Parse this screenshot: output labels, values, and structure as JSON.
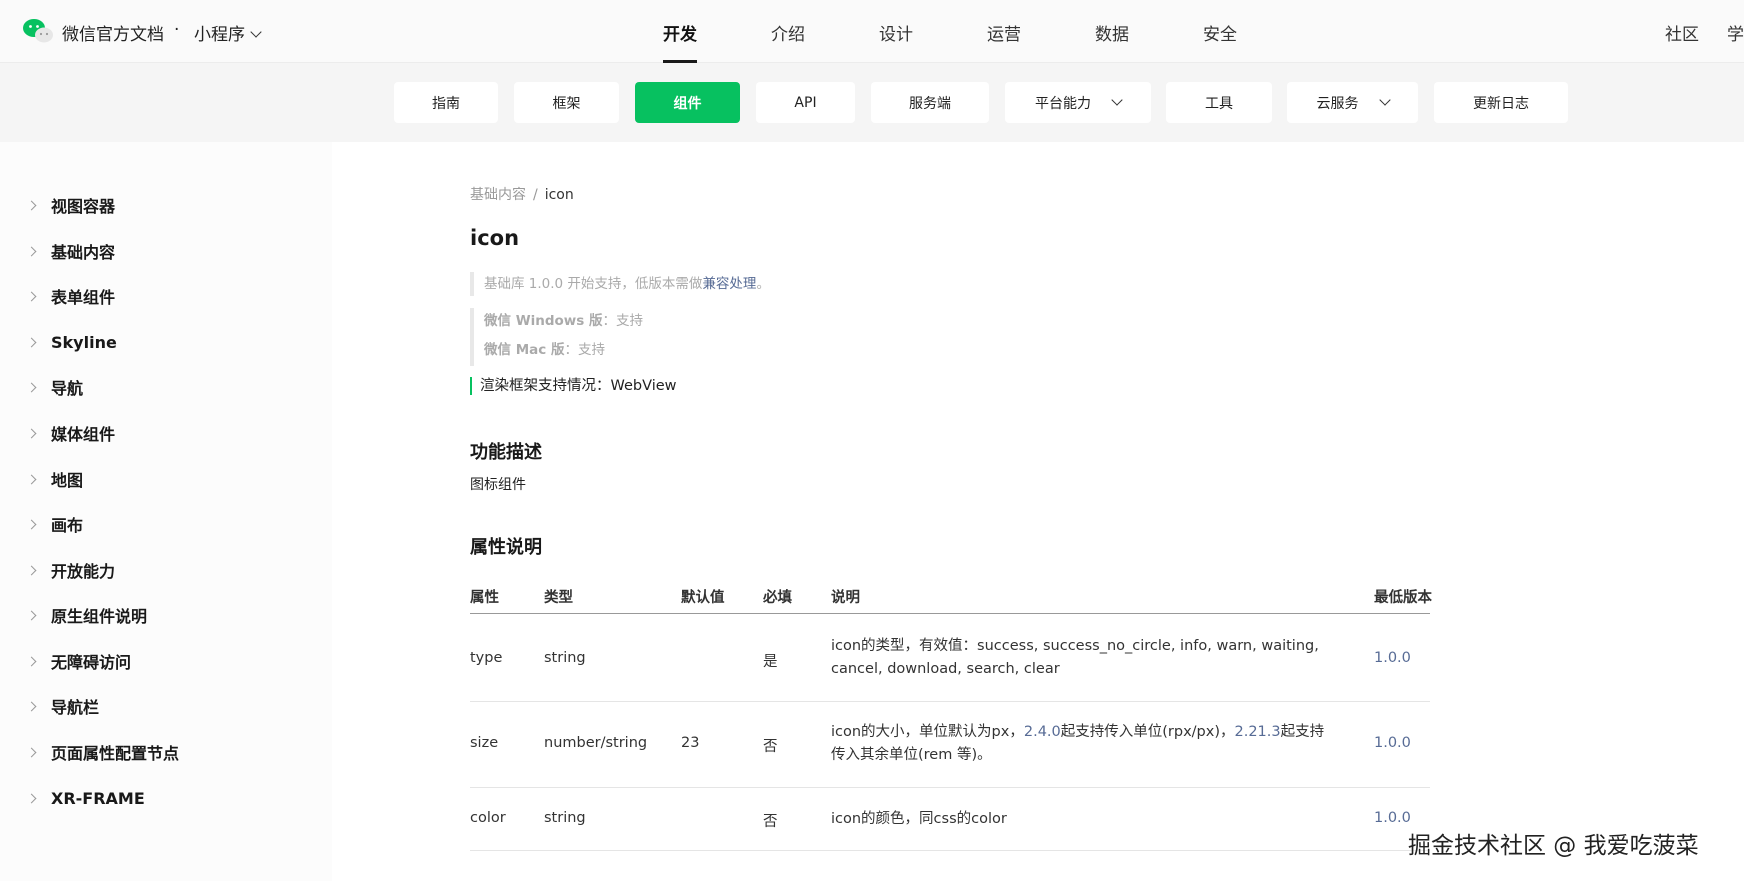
{
  "header": {
    "brand": "微信官方文档",
    "dot": "·",
    "product": "小程序",
    "nav": [
      {
        "label": "开发",
        "active": true
      },
      {
        "label": "介绍"
      },
      {
        "label": "设计"
      },
      {
        "label": "运营"
      },
      {
        "label": "数据"
      },
      {
        "label": "安全"
      }
    ],
    "right": [
      "社区",
      "学"
    ]
  },
  "subnav": [
    {
      "label": "指南"
    },
    {
      "label": "框架"
    },
    {
      "label": "组件",
      "active": true
    },
    {
      "label": "API"
    },
    {
      "label": "服务端"
    },
    {
      "label": "平台能力",
      "dropdown": true
    },
    {
      "label": "工具"
    },
    {
      "label": "云服务",
      "dropdown": true
    },
    {
      "label": "更新日志"
    }
  ],
  "sidebar": {
    "items": [
      "视图容器",
      "基础内容",
      "表单组件",
      "Skyline",
      "导航",
      "媒体组件",
      "地图",
      "画布",
      "开放能力",
      "原生组件说明",
      "无障碍访问",
      "导航栏",
      "页面属性配置节点",
      "XR-FRAME"
    ]
  },
  "content": {
    "breadcrumb": {
      "parent": "基础内容",
      "sep": "/",
      "current": "icon"
    },
    "title": "icon",
    "note_support": {
      "text": "基础库 1.0.0 开始支持，低版本需做",
      "link": "兼容处理",
      "end": "。"
    },
    "platforms": [
      {
        "name": "微信 Windows 版",
        "value": "：支持"
      },
      {
        "name": "微信 Mac 版",
        "value": "：支持"
      }
    ],
    "render": "渲染框架支持情况：WebView",
    "section_desc": "功能描述",
    "desc_text": "图标组件",
    "section_props": "属性说明"
  },
  "table": {
    "headers": [
      "属性",
      "类型",
      "默认值",
      "必填",
      "说明",
      "最低版本"
    ],
    "rows": [
      {
        "name": "type",
        "type": "string",
        "default": "",
        "required": "是",
        "desc_parts": [
          "icon的类型，有效值：success, success_no_circle, info, warn, waiting, cancel, download, search, clear"
        ],
        "version": "1.0.0"
      },
      {
        "name": "size",
        "type": "number/string",
        "default": "23",
        "required": "否",
        "desc_parts": [
          "icon的大小，单位默认为px，",
          "2.4.0",
          "起支持传入单位(rpx/px)，",
          "2.21.3",
          "起支持传入其余单位(rem 等)。"
        ],
        "version": "1.0.0"
      },
      {
        "name": "color",
        "type": "string",
        "default": "",
        "required": "否",
        "desc_parts": [
          "icon的颜色，同css的color"
        ],
        "version": "1.0.0"
      }
    ]
  },
  "watermark": "掘金技术社区 @ 我爱吃菠菜",
  "colors": {
    "accent": "#07c160",
    "link": "#576b95"
  }
}
